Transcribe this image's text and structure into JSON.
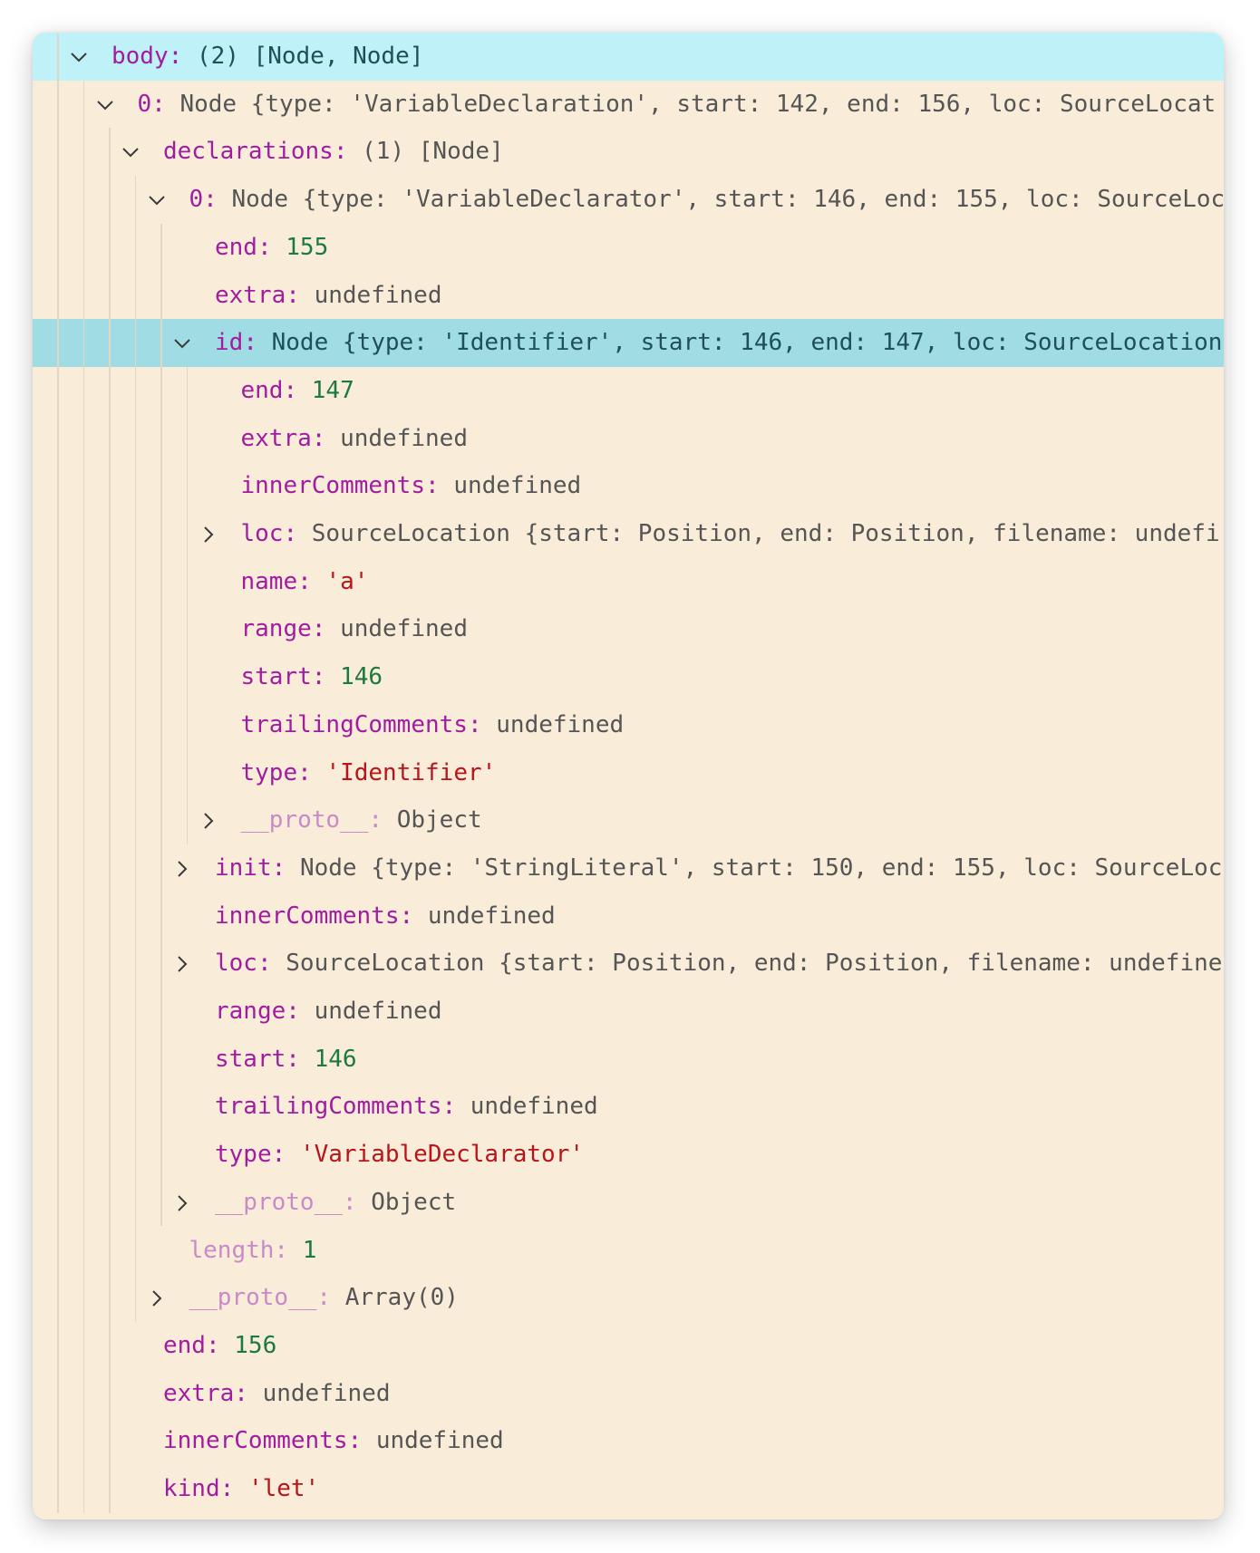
{
  "colors": {
    "background": "#f9edd9",
    "selected_row": "#bef1f8",
    "focused_row": "#9fdce4",
    "key": "#a21ca0",
    "internal_key": "#c88ac8",
    "number": "#1b7a3c",
    "string": "#b8141a",
    "plain": "#555555"
  },
  "tree": {
    "rows": [
      {
        "depth": 0,
        "toggle": "expanded",
        "key": "body",
        "value": "(2) [Node, Node]",
        "value_type": "plain",
        "highlight": "selected"
      },
      {
        "depth": 1,
        "toggle": "expanded",
        "key": "0",
        "value": "Node {type: 'VariableDeclaration', start: 142, end: 156, loc: SourceLocat",
        "value_type": "plain"
      },
      {
        "depth": 2,
        "toggle": "expanded",
        "key": "declarations",
        "value": "(1) [Node]",
        "value_type": "plain"
      },
      {
        "depth": 3,
        "toggle": "expanded",
        "key": "0",
        "value": "Node {type: 'VariableDeclarator', start: 146, end: 155, loc: SourceLoc",
        "value_type": "plain"
      },
      {
        "depth": 4,
        "key": "end",
        "value": "155",
        "value_type": "number"
      },
      {
        "depth": 4,
        "key": "extra",
        "value": "undefined",
        "value_type": "plain"
      },
      {
        "depth": 4,
        "toggle": "expanded",
        "key": "id",
        "value": "Node {type: 'Identifier', start: 146, end: 147, loc: SourceLocation",
        "value_type": "plain",
        "highlight": "focused"
      },
      {
        "depth": 5,
        "key": "end",
        "value": "147",
        "value_type": "number"
      },
      {
        "depth": 5,
        "key": "extra",
        "value": "undefined",
        "value_type": "plain"
      },
      {
        "depth": 5,
        "key": "innerComments",
        "value": "undefined",
        "value_type": "plain"
      },
      {
        "depth": 5,
        "toggle": "collapsed",
        "key": "loc",
        "value": "SourceLocation {start: Position, end: Position, filename: undefi",
        "value_type": "plain"
      },
      {
        "depth": 5,
        "key": "name",
        "value": "'a'",
        "value_type": "string"
      },
      {
        "depth": 5,
        "key": "range",
        "value": "undefined",
        "value_type": "plain"
      },
      {
        "depth": 5,
        "key": "start",
        "value": "146",
        "value_type": "number"
      },
      {
        "depth": 5,
        "key": "trailingComments",
        "value": "undefined",
        "value_type": "plain"
      },
      {
        "depth": 5,
        "key": "type",
        "value": "'Identifier'",
        "value_type": "string"
      },
      {
        "depth": 5,
        "toggle": "collapsed",
        "key": "__proto__",
        "key_dim": true,
        "value": "Object",
        "value_type": "plain"
      },
      {
        "depth": 4,
        "toggle": "collapsed",
        "key": "init",
        "value": "Node {type: 'StringLiteral', start: 150, end: 155, loc: SourceLoc",
        "value_type": "plain"
      },
      {
        "depth": 4,
        "key": "innerComments",
        "value": "undefined",
        "value_type": "plain"
      },
      {
        "depth": 4,
        "toggle": "collapsed",
        "key": "loc",
        "value": "SourceLocation {start: Position, end: Position, filename: undefine",
        "value_type": "plain"
      },
      {
        "depth": 4,
        "key": "range",
        "value": "undefined",
        "value_type": "plain"
      },
      {
        "depth": 4,
        "key": "start",
        "value": "146",
        "value_type": "number"
      },
      {
        "depth": 4,
        "key": "trailingComments",
        "value": "undefined",
        "value_type": "plain"
      },
      {
        "depth": 4,
        "key": "type",
        "value": "'VariableDeclarator'",
        "value_type": "string"
      },
      {
        "depth": 4,
        "toggle": "collapsed",
        "key": "__proto__",
        "key_dim": true,
        "value": "Object",
        "value_type": "plain"
      },
      {
        "depth": 3,
        "key": "length",
        "key_dim": true,
        "value": "1",
        "value_type": "number"
      },
      {
        "depth": 3,
        "toggle": "collapsed",
        "key": "__proto__",
        "key_dim": true,
        "value": "Array(0)",
        "value_type": "plain"
      },
      {
        "depth": 2,
        "key": "end",
        "value": "156",
        "value_type": "number"
      },
      {
        "depth": 2,
        "key": "extra",
        "value": "undefined",
        "value_type": "plain"
      },
      {
        "depth": 2,
        "key": "innerComments",
        "value": "undefined",
        "value_type": "plain"
      },
      {
        "depth": 2,
        "key": "kind",
        "value": "'let'",
        "value_type": "string"
      }
    ]
  }
}
